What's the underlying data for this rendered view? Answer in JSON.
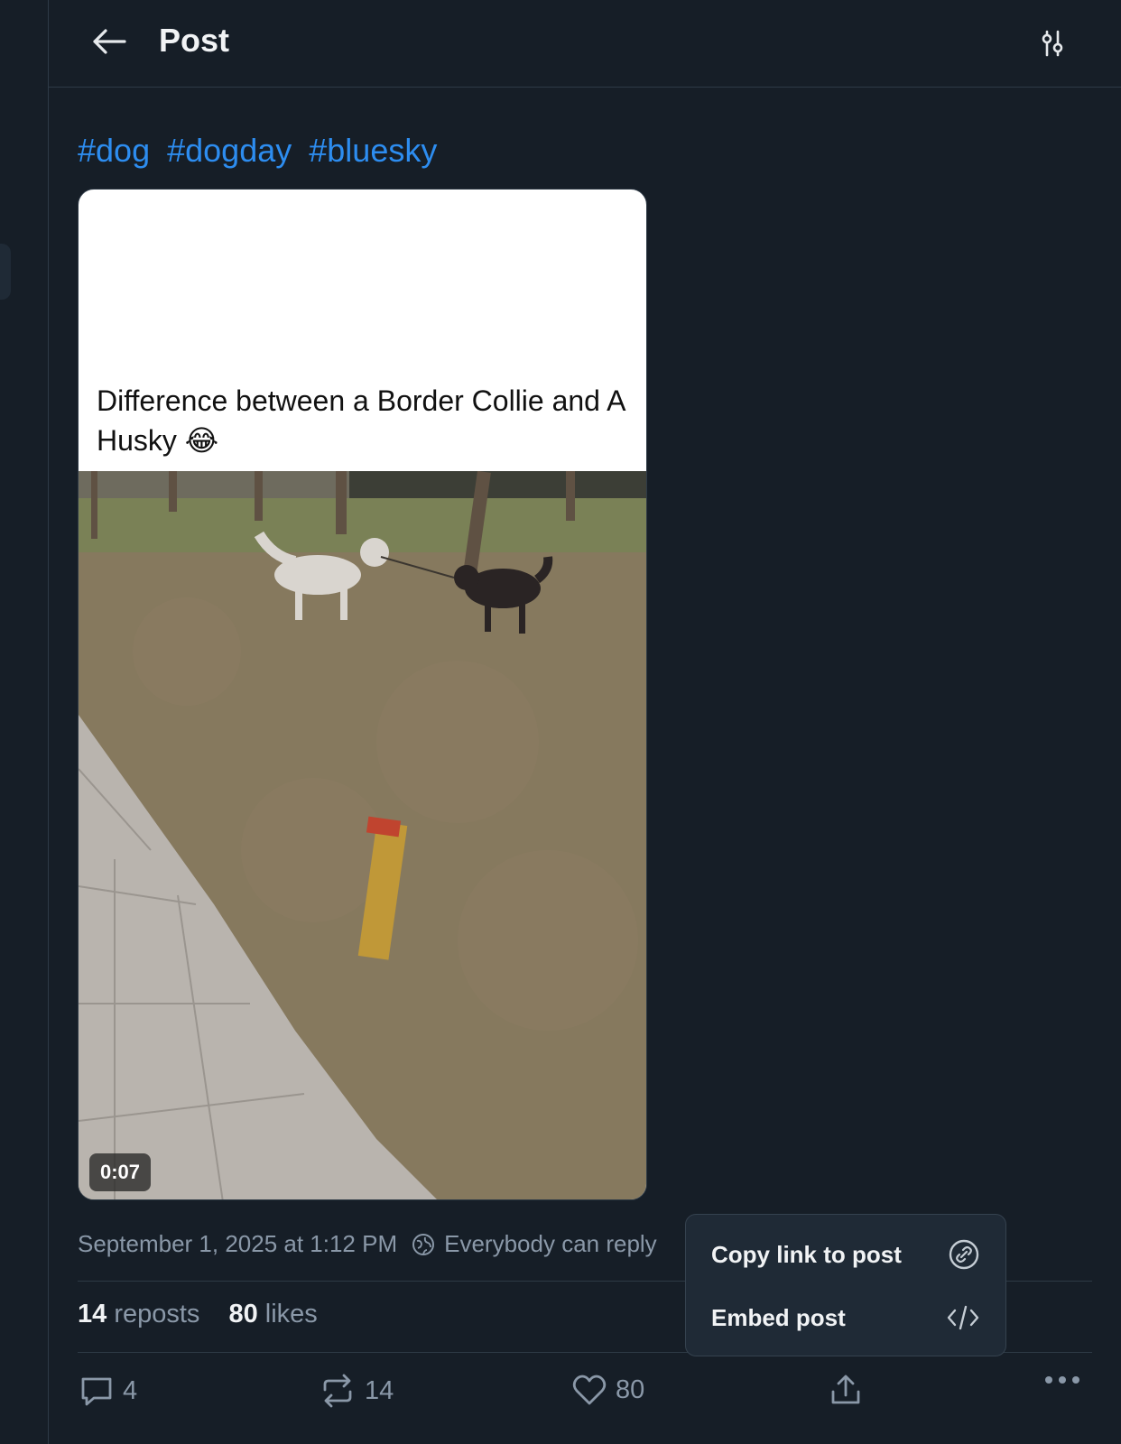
{
  "header": {
    "title": "Post"
  },
  "post": {
    "hashtags": [
      "#dog",
      "#dogday",
      "#bluesky"
    ],
    "video": {
      "caption": "Difference between a Border Collie and A Husky 😂",
      "duration": "0:07"
    },
    "timestamp": "September 1, 2025 at 1:12 PM",
    "reply_setting": "Everybody can reply",
    "stats": {
      "reposts_count": "14",
      "reposts_label": "reposts",
      "likes_count": "80",
      "likes_label": "likes"
    },
    "actions": {
      "replies": "4",
      "reposts": "14",
      "likes": "80"
    }
  },
  "context_menu": {
    "items": [
      {
        "label": "Copy link to post",
        "icon": "link-icon"
      },
      {
        "label": "Embed post",
        "icon": "code-icon"
      }
    ]
  },
  "colors": {
    "background": "#161e27",
    "accent": "#2d8df0",
    "muted_text": "#8a98a8",
    "border": "#2e3a46",
    "menu_bg": "#1f2a36"
  }
}
